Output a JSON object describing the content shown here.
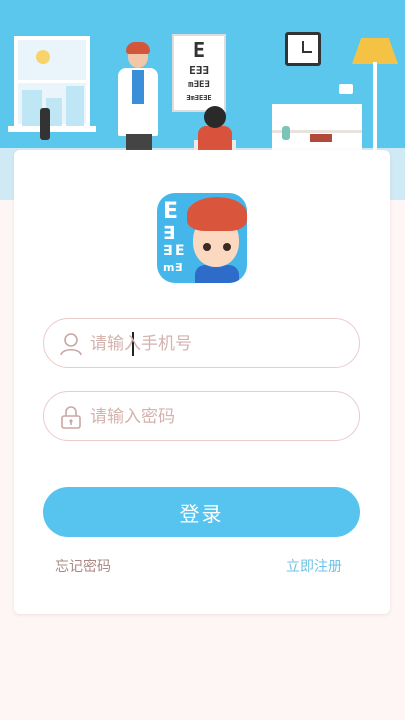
{
  "header": {
    "eye_chart_rows": [
      "E",
      "E∃∃",
      "m∃E∃",
      "∃m∃E∃E"
    ]
  },
  "logo": {
    "letters": [
      "E",
      "∃",
      "∃",
      "E",
      "m",
      "∃"
    ]
  },
  "form": {
    "phone_placeholder": "请输入手机号",
    "password_placeholder": "请输入密码",
    "login_label": "登录",
    "forgot_label": "忘记密码",
    "register_label": "立即注册"
  },
  "colors": {
    "accent": "#56c4ef",
    "banner": "#5cc7ec",
    "field_border": "#eccbcb",
    "placeholder": "#d4b2ae",
    "forgot_text": "#a98884",
    "register_text": "#6fc2e6"
  },
  "icons": {
    "phone_field": "user-icon",
    "password_field": "lock-icon"
  }
}
